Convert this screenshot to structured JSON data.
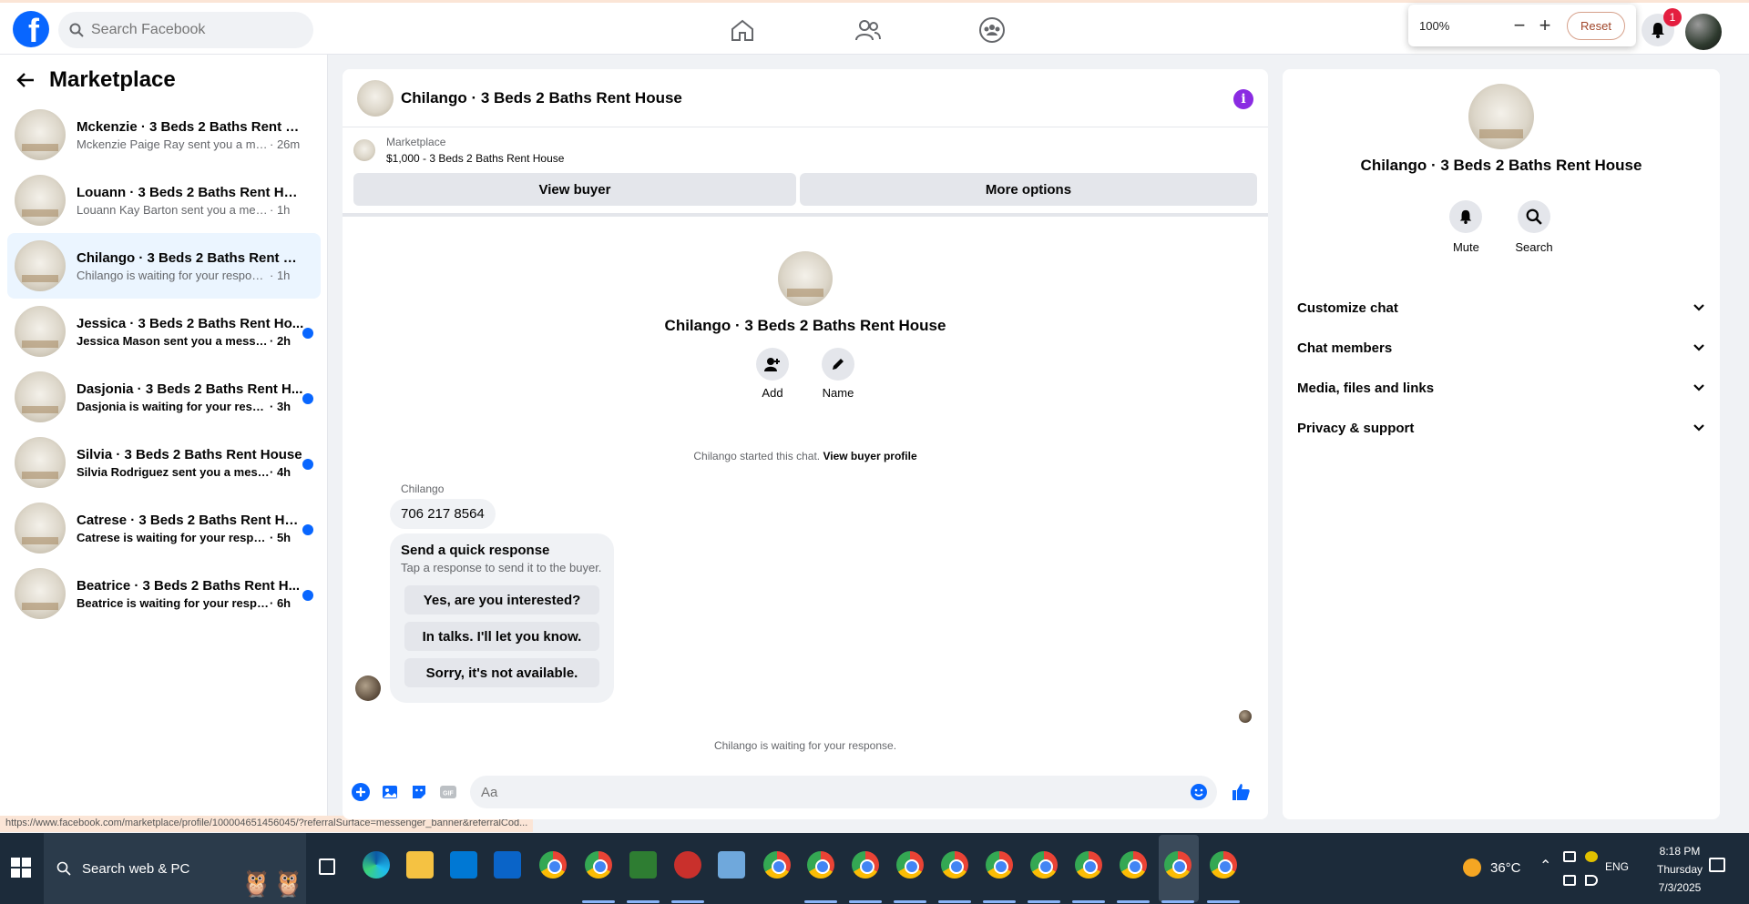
{
  "topbar": {
    "search_placeholder": "Search Facebook",
    "zoom_level": "100%",
    "zoom_out": "−",
    "zoom_in": "+",
    "reset_label": "Reset",
    "notif_count": "1",
    "logo_letter": "f"
  },
  "sidebar": {
    "title": "Marketplace",
    "conversations": [
      {
        "title": "Mckenzie · 3 Beds 2 Baths Rent Ho...",
        "msg": "Mckenzie Paige Ray sent you a mes...",
        "time": "· 26m"
      },
      {
        "title": "Louann · 3 Beds 2 Baths Rent House",
        "msg": "Louann Kay Barton sent you a messag...",
        "time": "· 1h"
      },
      {
        "title": "Chilango · 3 Beds 2 Baths Rent Ho...",
        "msg": "Chilango is waiting for your response.",
        "time": "· 1h"
      },
      {
        "title": "Jessica · 3 Beds 2 Baths Rent Ho...",
        "msg": "Jessica Mason sent you a message ...",
        "time": "· 2h"
      },
      {
        "title": "Dasjonia · 3 Beds 2 Baths Rent H...",
        "msg": "Dasjonia is waiting for your respo...",
        "time": "· 3h"
      },
      {
        "title": "Silvia · 3 Beds 2 Baths Rent House",
        "msg": "Silvia Rodriguez sent you a messa...",
        "time": "· 4h"
      },
      {
        "title": "Catrese · 3 Beds 2 Baths Rent Ho...",
        "msg": "Catrese is waiting for your response.",
        "time": "· 5h"
      },
      {
        "title": "Beatrice · 3 Beds 2 Baths Rent H...",
        "msg": "Beatrice is waiting for your respon...",
        "time": "· 6h"
      }
    ],
    "status_url": "https://www.facebook.com/marketplace/profile/100004651456045/?referralSurface=messenger_banner&referralCod..."
  },
  "chat": {
    "title": "Chilango · 3 Beds 2 Baths Rent House",
    "info_glyph": "i",
    "market_label": "Marketplace",
    "market_listing": "$1,000 - 3 Beds 2 Baths Rent House",
    "view_buyer": "View buyer",
    "more_options": "More options",
    "profile_name": "Chilango · 3 Beds 2 Baths Rent House",
    "add_label": "Add",
    "name_label": "Name",
    "started_text": "Chilango started this chat.",
    "view_profile": "View buyer profile",
    "sender": "Chilango",
    "phone": "706 217 8564",
    "quick_title": "Send a quick response",
    "quick_sub": "Tap a response to send it to the buyer.",
    "quick_replies": [
      "Yes, are you interested?",
      "In talks. I'll let you know.",
      "Sorry, it's not available."
    ],
    "waiting": "Chilango is waiting for your response.",
    "composer_placeholder": "Aa"
  },
  "info_panel": {
    "title": "Chilango · 3 Beds 2 Baths Rent House",
    "mute": "Mute",
    "search": "Search",
    "sections": [
      "Customize chat",
      "Chat members",
      "Media, files and links",
      "Privacy & support"
    ]
  },
  "taskbar": {
    "search": "Search web & PC",
    "temp": "36°C",
    "lang": "ENG",
    "time": "8:18 PM",
    "day": "Thursday",
    "date": "7/3/2025"
  },
  "colors": {
    "brand": "#0866ff",
    "unread_dot": "#0866ff",
    "info_button": "#8a2be2",
    "active_row": "#ebf5ff"
  }
}
